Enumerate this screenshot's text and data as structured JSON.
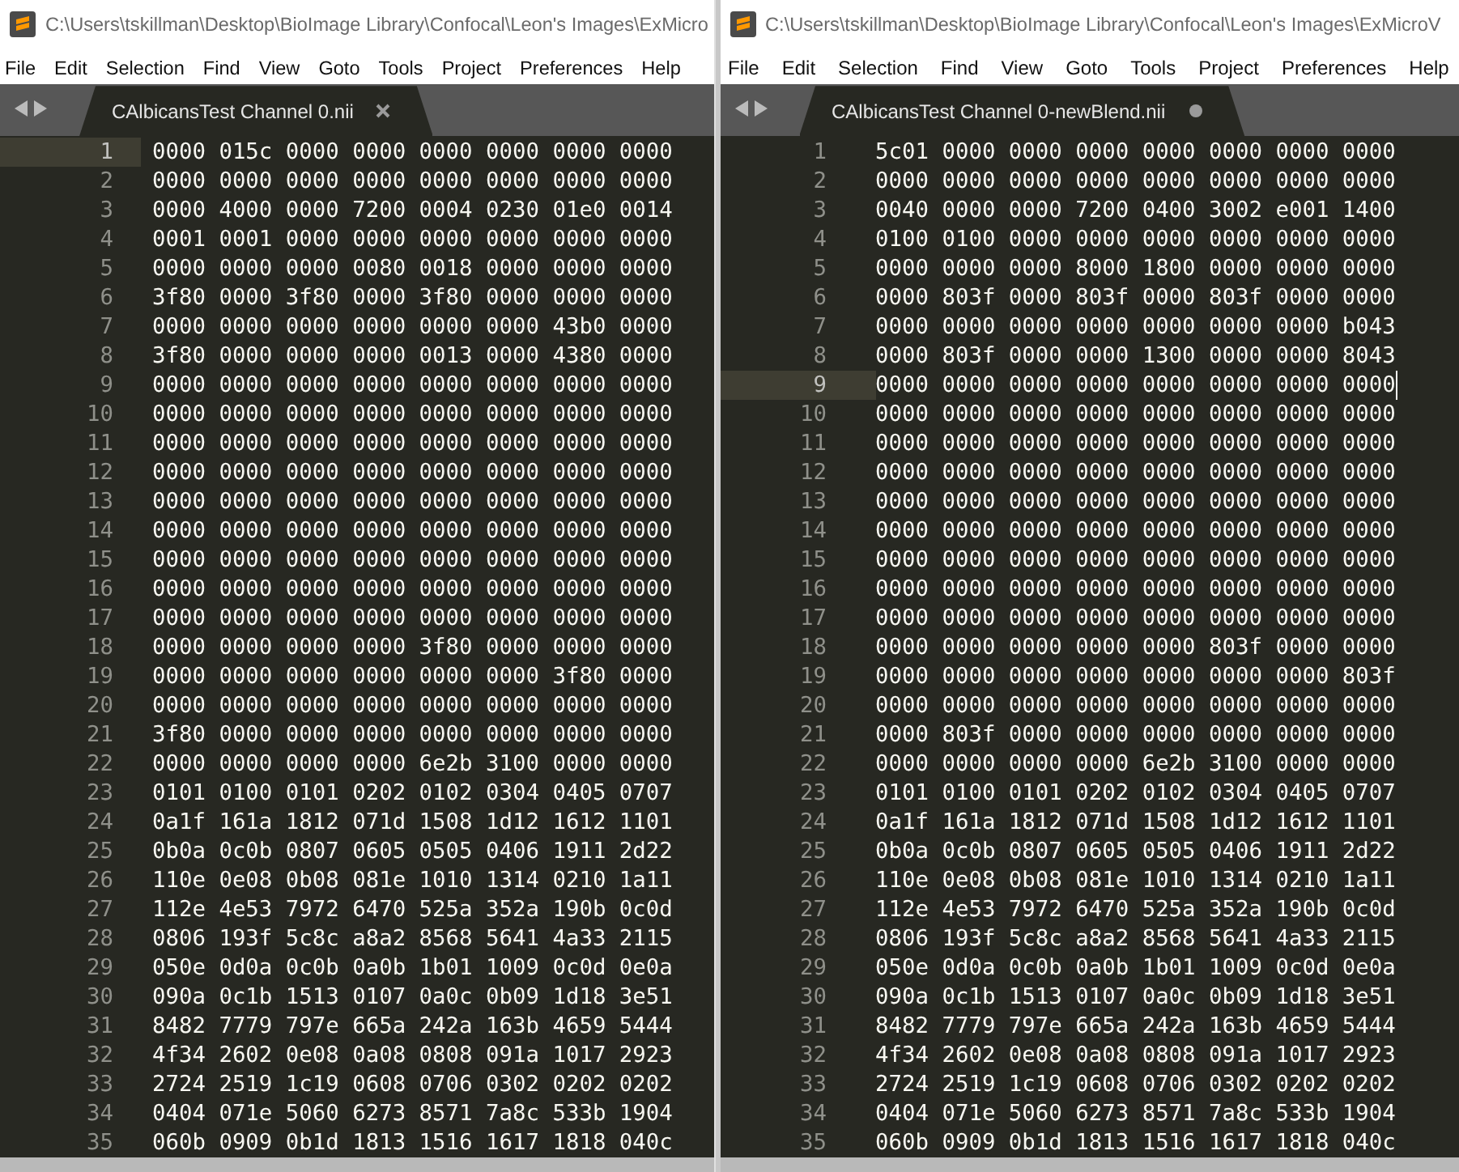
{
  "windows": [
    {
      "title": "C:\\Users\\tskillman\\Desktop\\BioImage Library\\Confocal\\Leon's Images\\ExMicro",
      "focused": false,
      "menu": [
        "File",
        "Edit",
        "Selection",
        "Find",
        "View",
        "Goto",
        "Tools",
        "Project",
        "Preferences",
        "Help"
      ],
      "tab": {
        "label": "CAlbicansTest Channel 0.nii",
        "modified": false
      },
      "lines": [
        {
          "number": "1",
          "text": "0000 015c 0000 0000 0000 0000 0000 0000",
          "current": true
        },
        {
          "number": "2",
          "text": "0000 0000 0000 0000 0000 0000 0000 0000",
          "current": false
        },
        {
          "number": "3",
          "text": "0000 4000 0000 7200 0004 0230 01e0 0014",
          "current": false
        },
        {
          "number": "4",
          "text": "0001 0001 0000 0000 0000 0000 0000 0000",
          "current": false
        },
        {
          "number": "5",
          "text": "0000 0000 0000 0080 0018 0000 0000 0000",
          "current": false
        },
        {
          "number": "6",
          "text": "3f80 0000 3f80 0000 3f80 0000 0000 0000",
          "current": false
        },
        {
          "number": "7",
          "text": "0000 0000 0000 0000 0000 0000 43b0 0000",
          "current": false
        },
        {
          "number": "8",
          "text": "3f80 0000 0000 0000 0013 0000 4380 0000",
          "current": false
        },
        {
          "number": "9",
          "text": "0000 0000 0000 0000 0000 0000 0000 0000",
          "current": false
        },
        {
          "number": "10",
          "text": "0000 0000 0000 0000 0000 0000 0000 0000",
          "current": false
        },
        {
          "number": "11",
          "text": "0000 0000 0000 0000 0000 0000 0000 0000",
          "current": false
        },
        {
          "number": "12",
          "text": "0000 0000 0000 0000 0000 0000 0000 0000",
          "current": false
        },
        {
          "number": "13",
          "text": "0000 0000 0000 0000 0000 0000 0000 0000",
          "current": false
        },
        {
          "number": "14",
          "text": "0000 0000 0000 0000 0000 0000 0000 0000",
          "current": false
        },
        {
          "number": "15",
          "text": "0000 0000 0000 0000 0000 0000 0000 0000",
          "current": false
        },
        {
          "number": "16",
          "text": "0000 0000 0000 0000 0000 0000 0000 0000",
          "current": false
        },
        {
          "number": "17",
          "text": "0000 0000 0000 0000 0000 0000 0000 0000",
          "current": false
        },
        {
          "number": "18",
          "text": "0000 0000 0000 0000 3f80 0000 0000 0000",
          "current": false
        },
        {
          "number": "19",
          "text": "0000 0000 0000 0000 0000 0000 3f80 0000",
          "current": false
        },
        {
          "number": "20",
          "text": "0000 0000 0000 0000 0000 0000 0000 0000",
          "current": false
        },
        {
          "number": "21",
          "text": "3f80 0000 0000 0000 0000 0000 0000 0000",
          "current": false
        },
        {
          "number": "22",
          "text": "0000 0000 0000 0000 6e2b 3100 0000 0000",
          "current": false
        },
        {
          "number": "23",
          "text": "0101 0100 0101 0202 0102 0304 0405 0707",
          "current": false
        },
        {
          "number": "24",
          "text": "0a1f 161a 1812 071d 1508 1d12 1612 1101",
          "current": false
        },
        {
          "number": "25",
          "text": "0b0a 0c0b 0807 0605 0505 0406 1911 2d22",
          "current": false
        },
        {
          "number": "26",
          "text": "110e 0e08 0b08 081e 1010 1314 0210 1a11",
          "current": false
        },
        {
          "number": "27",
          "text": "112e 4e53 7972 6470 525a 352a 190b 0c0d",
          "current": false
        },
        {
          "number": "28",
          "text": "0806 193f 5c8c a8a2 8568 5641 4a33 2115",
          "current": false
        },
        {
          "number": "29",
          "text": "050e 0d0a 0c0b 0a0b 1b01 1009 0c0d 0e0a",
          "current": false
        },
        {
          "number": "30",
          "text": "090a 0c1b 1513 0107 0a0c 0b09 1d18 3e51",
          "current": false
        },
        {
          "number": "31",
          "text": "8482 7779 797e 665a 242a 163b 4659 5444",
          "current": false
        },
        {
          "number": "32",
          "text": "4f34 2602 0e08 0a08 0808 091a 1017 2923",
          "current": false
        },
        {
          "number": "33",
          "text": "2724 2519 1c19 0608 0706 0302 0202 0202",
          "current": false
        },
        {
          "number": "34",
          "text": "0404 071e 5060 6273 8571 7a8c 533b 1904",
          "current": false
        },
        {
          "number": "35",
          "text": "060b 0909 0b1d 1813 1516 1617 1818 040c",
          "current": false
        }
      ]
    },
    {
      "title": "C:\\Users\\tskillman\\Desktop\\BioImage Library\\Confocal\\Leon's Images\\ExMicroV",
      "focused": true,
      "menu": [
        "File",
        "Edit",
        "Selection",
        "Find",
        "View",
        "Goto",
        "Tools",
        "Project",
        "Preferences",
        "Help"
      ],
      "tab": {
        "label": "CAlbicansTest Channel 0-newBlend.nii",
        "modified": true
      },
      "lines": [
        {
          "number": "1",
          "text": "5c01 0000 0000 0000 0000 0000 0000 0000",
          "current": false
        },
        {
          "number": "2",
          "text": "0000 0000 0000 0000 0000 0000 0000 0000",
          "current": false
        },
        {
          "number": "3",
          "text": "0040 0000 0000 7200 0400 3002 e001 1400",
          "current": false
        },
        {
          "number": "4",
          "text": "0100 0100 0000 0000 0000 0000 0000 0000",
          "current": false
        },
        {
          "number": "5",
          "text": "0000 0000 0000 8000 1800 0000 0000 0000",
          "current": false
        },
        {
          "number": "6",
          "text": "0000 803f 0000 803f 0000 803f 0000 0000",
          "current": false
        },
        {
          "number": "7",
          "text": "0000 0000 0000 0000 0000 0000 0000 b043",
          "current": false
        },
        {
          "number": "8",
          "text": "0000 803f 0000 0000 1300 0000 0000 8043",
          "current": false
        },
        {
          "number": "9",
          "text": "0000 0000 0000 0000 0000 0000 0000 0000",
          "current": true
        },
        {
          "number": "10",
          "text": "0000 0000 0000 0000 0000 0000 0000 0000",
          "current": false
        },
        {
          "number": "11",
          "text": "0000 0000 0000 0000 0000 0000 0000 0000",
          "current": false
        },
        {
          "number": "12",
          "text": "0000 0000 0000 0000 0000 0000 0000 0000",
          "current": false
        },
        {
          "number": "13",
          "text": "0000 0000 0000 0000 0000 0000 0000 0000",
          "current": false
        },
        {
          "number": "14",
          "text": "0000 0000 0000 0000 0000 0000 0000 0000",
          "current": false
        },
        {
          "number": "15",
          "text": "0000 0000 0000 0000 0000 0000 0000 0000",
          "current": false
        },
        {
          "number": "16",
          "text": "0000 0000 0000 0000 0000 0000 0000 0000",
          "current": false
        },
        {
          "number": "17",
          "text": "0000 0000 0000 0000 0000 0000 0000 0000",
          "current": false
        },
        {
          "number": "18",
          "text": "0000 0000 0000 0000 0000 803f 0000 0000",
          "current": false
        },
        {
          "number": "19",
          "text": "0000 0000 0000 0000 0000 0000 0000 803f",
          "current": false
        },
        {
          "number": "20",
          "text": "0000 0000 0000 0000 0000 0000 0000 0000",
          "current": false
        },
        {
          "number": "21",
          "text": "0000 803f 0000 0000 0000 0000 0000 0000",
          "current": false
        },
        {
          "number": "22",
          "text": "0000 0000 0000 0000 6e2b 3100 0000 0000",
          "current": false
        },
        {
          "number": "23",
          "text": "0101 0100 0101 0202 0102 0304 0405 0707",
          "current": false
        },
        {
          "number": "24",
          "text": "0a1f 161a 1812 071d 1508 1d12 1612 1101",
          "current": false
        },
        {
          "number": "25",
          "text": "0b0a 0c0b 0807 0605 0505 0406 1911 2d22",
          "current": false
        },
        {
          "number": "26",
          "text": "110e 0e08 0b08 081e 1010 1314 0210 1a11",
          "current": false
        },
        {
          "number": "27",
          "text": "112e 4e53 7972 6470 525a 352a 190b 0c0d",
          "current": false
        },
        {
          "number": "28",
          "text": "0806 193f 5c8c a8a2 8568 5641 4a33 2115",
          "current": false
        },
        {
          "number": "29",
          "text": "050e 0d0a 0c0b 0a0b 1b01 1009 0c0d 0e0a",
          "current": false
        },
        {
          "number": "30",
          "text": "090a 0c1b 1513 0107 0a0c 0b09 1d18 3e51",
          "current": false
        },
        {
          "number": "31",
          "text": "8482 7779 797e 665a 242a 163b 4659 5444",
          "current": false
        },
        {
          "number": "32",
          "text": "4f34 2602 0e08 0a08 0808 091a 1017 2923",
          "current": false
        },
        {
          "number": "33",
          "text": "2724 2519 1c19 0608 0706 0302 0202 0202",
          "current": false
        },
        {
          "number": "34",
          "text": "0404 071e 5060 6273 8571 7a8c 533b 1904",
          "current": false
        },
        {
          "number": "35",
          "text": "060b 0909 0b1d 1813 1516 1617 1818 040c",
          "current": false
        }
      ]
    }
  ]
}
